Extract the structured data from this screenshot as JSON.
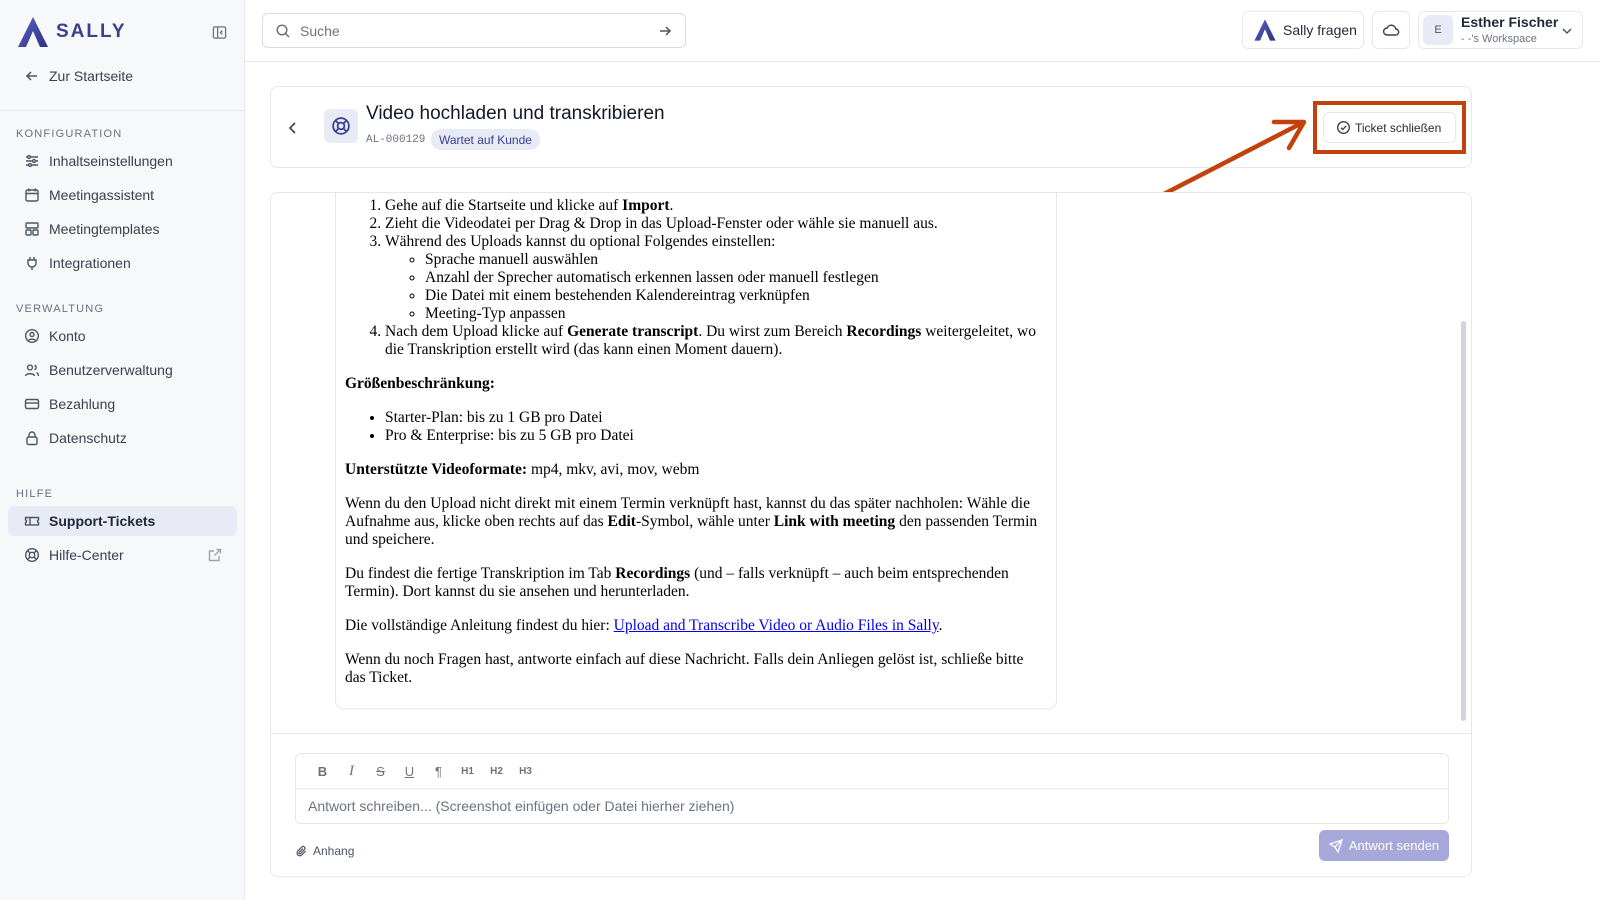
{
  "app": {
    "name": "SALLY"
  },
  "sidebar": {
    "back_label": "Zur Startseite",
    "sections": [
      {
        "label": "KONFIGURATION",
        "items": [
          {
            "label": "Inhaltseinstellungen",
            "icon": "sliders-icon"
          },
          {
            "label": "Meetingassistent",
            "icon": "calendar-icon"
          },
          {
            "label": "Meetingtemplates",
            "icon": "layout-icon"
          },
          {
            "label": "Integrationen",
            "icon": "plug-icon"
          }
        ]
      },
      {
        "label": "VERWALTUNG",
        "items": [
          {
            "label": "Konto",
            "icon": "user-circle-icon"
          },
          {
            "label": "Benutzerverwaltung",
            "icon": "users-icon"
          },
          {
            "label": "Bezahlung",
            "icon": "credit-card-icon"
          },
          {
            "label": "Datenschutz",
            "icon": "lock-icon"
          }
        ]
      },
      {
        "label": "HILFE",
        "items": [
          {
            "label": "Support-Tickets",
            "icon": "ticket-icon",
            "active": true
          },
          {
            "label": "Hilfe-Center",
            "icon": "lifebuoy-icon",
            "external": true
          }
        ]
      }
    ]
  },
  "topbar": {
    "search_placeholder": "Suche",
    "ask_label": "Sally fragen",
    "user": {
      "initial": "E",
      "name": "Esther Fischer",
      "workspace": "- -'s Workspace"
    }
  },
  "ticket": {
    "title": "Video hochladen und transkribieren",
    "id": "AL-000129",
    "status": "Wartet auf Kunde",
    "close_label": "Ticket schließen"
  },
  "message": {
    "steps": [
      {
        "pre": "Gehe auf die Startseite und klicke auf ",
        "bold": "Import",
        "post": "."
      },
      {
        "pre": "Zieht die Videodatei per Drag & Drop in das Upload-Fenster oder wähle sie manuell aus."
      },
      {
        "pre": "Während des Uploads kannst du optional Folgendes einstellen:"
      },
      {
        "pre": "Nach dem Upload klicke auf ",
        "bold": "Generate transcript",
        "mid": ". Du wirst zum Bereich ",
        "bold2": "Recordings",
        "post": " weitergeleitet, wo die Transkription erstellt wird (das kann einen Moment dauern)."
      }
    ],
    "options": [
      "Sprache manuell auswählen",
      "Anzahl der Sprecher automatisch erkennen lassen oder manuell festlegen",
      "Die Datei mit einem bestehenden Kalendereintrag verknüpfen",
      "Meeting-Typ anpassen"
    ],
    "size_heading": "Größenbeschränkung:",
    "size_limits": [
      "Starter-Plan: bis zu 1 GB pro Datei",
      "Pro & Enterprise: bis zu 5 GB pro Datei"
    ],
    "formats_label": "Unterstützte Videoformate:",
    "formats_value": " mp4, mkv, avi, mov, webm",
    "p_link_1": "Wenn du den Upload nicht direkt mit einem Termin verknüpft hast, kannst du das später nachholen: Wähle die Aufnahme aus, klicke oben rechts auf das ",
    "p_link_bold_1": "Edit",
    "p_link_2": "-Symbol, wähle unter ",
    "p_link_bold_2": "Link with meeting",
    "p_link_3": " den passenden Termin und speichere.",
    "p_find_1": "Du findest die fertige Transkription im Tab ",
    "p_find_bold": "Recordings",
    "p_find_2": " (und – falls verknüpft – auch beim entsprechenden Termin). Dort kannst du sie ansehen und herunterladen.",
    "p_guide_pre": "Die vollständige Anleitung findest du hier: ",
    "p_guide_link": "Upload and Transcribe Video or Audio Files in Sally",
    "p_guide_post": ".",
    "p_outro": "Wenn du noch Fragen hast, antworte einfach auf diese Nachricht. Falls dein Anliegen gelöst ist, schließe bitte das Ticket."
  },
  "editor": {
    "toolbar": [
      "B",
      "I",
      "S",
      "U",
      "¶",
      "H1",
      "H2",
      "H3"
    ],
    "placeholder": "Antwort schreiben... (Screenshot einfügen oder Datei hierher ziehen)",
    "attach_label": "Anhang",
    "send_label": "Antwort senden"
  },
  "colors": {
    "brand": "#3b3f8f",
    "highlight": "#c2410c",
    "send_disabled": "#a5a8d8"
  }
}
